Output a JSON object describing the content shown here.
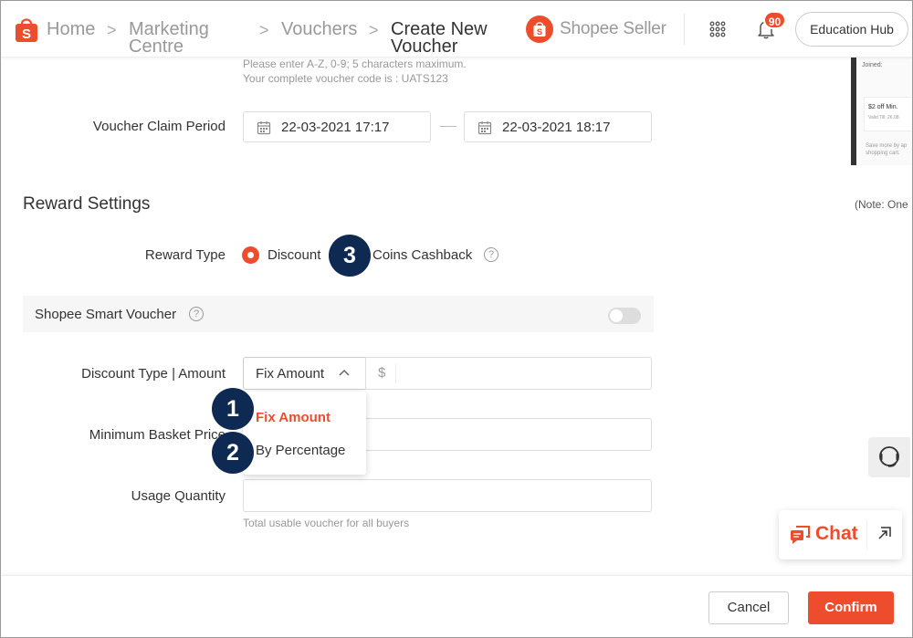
{
  "header": {
    "breadcrumb": {
      "home": "Home",
      "marketing_line1": "Marketing",
      "marketing_line2": "Centre",
      "vouchers": "Vouchers",
      "current_line1": "Create New",
      "current_line2": "Voucher",
      "separator": ">"
    },
    "brand": "Shopee Seller",
    "notification_count": "90",
    "education_hub": "Education Hub"
  },
  "preview": {
    "joined": "Joined:",
    "voucher_title": "$2 off Min.",
    "voucher_valid": "Valid Till: 26.08.",
    "footer_text": "Save more by ap shopping cart."
  },
  "voucher_code": {
    "hint1": "Please enter A-Z, 0-9; 5 characters maximum.",
    "hint2": "Your complete voucher code is :  UATS123"
  },
  "claim_period": {
    "label": "Voucher Claim Period",
    "start": "22-03-2021 17:17",
    "end": "22-03-2021 18:17"
  },
  "reward_settings": {
    "title": "Reward Settings",
    "note": "(Note: One",
    "reward_type_label": "Reward Type",
    "options": [
      "Discount",
      "Coins Cashback"
    ],
    "selected": "Discount"
  },
  "smart_voucher": {
    "label": "Shopee Smart Voucher",
    "enabled": false
  },
  "discount": {
    "label": "Discount Type | Amount",
    "selected": "Fix Amount",
    "currency": "$",
    "dropdown_options": [
      "Fix Amount",
      "By Percentage"
    ]
  },
  "min_basket": {
    "label": "Minimum Basket Price"
  },
  "usage": {
    "label": "Usage Quantity",
    "hint": "Total usable voucher for all buyers"
  },
  "markers": [
    "1",
    "2",
    "3"
  ],
  "chat": {
    "label": "Chat"
  },
  "footer": {
    "cancel": "Cancel",
    "confirm": "Confirm"
  },
  "colors": {
    "accent": "#ee4d2d",
    "marker": "#0e2a52"
  },
  "help_symbol": "?"
}
